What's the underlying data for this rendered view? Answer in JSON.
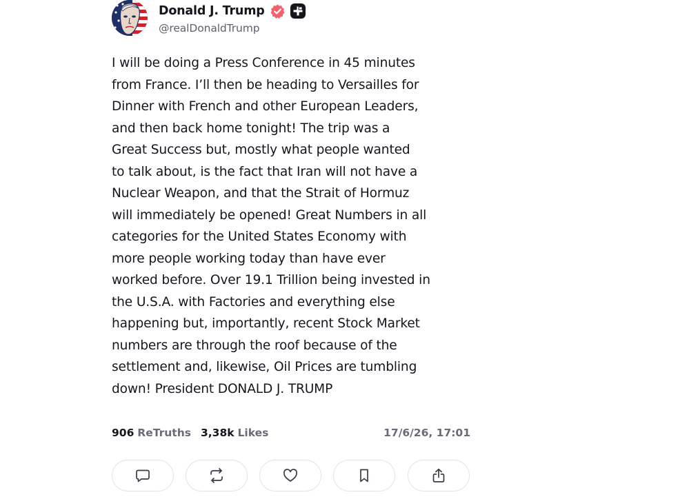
{
  "author": {
    "display_name": "Donald J. Trump",
    "handle": "@realDonaldTrump",
    "verified_icon": "verified-badge-icon",
    "subscribe_icon": "subscribe-plus-icon",
    "avatar_icon": "profile-avatar"
  },
  "post": {
    "lines": [
      "I will be doing a Press Conference in 45 minutes",
      "from France. I’ll then be heading to Versailles for",
      "Dinner with French and other European Leaders,",
      "and then back home tonight! The trip was a",
      "Great Success but, mostly what people wanted",
      "to talk about, is the fact that Iran will not have a",
      "Nuclear Weapon, and that the Strait of Hormuz",
      "will immediately be opened! Great Numbers in all",
      "categories for the United States Economy with",
      "more people working today than have ever",
      "worked before. Over 19.1 Trillion being invested in",
      "the U.S.A. with Factories and everything else",
      "happening but, importantly, recent Stock Market",
      "numbers are through the roof because of the",
      "settlement and, likewise, Oil Prices are tumbling",
      "down! President DONALD J. TRUMP"
    ]
  },
  "stats": {
    "retruths_count": "906",
    "retruths_label": "ReTruths",
    "likes_count": "3,38k",
    "likes_label": "Likes",
    "timestamp": "17/6/26, 17:01"
  },
  "actions": [
    {
      "name": "reply",
      "icon": "comment-icon"
    },
    {
      "name": "retruth",
      "icon": "repost-icon"
    },
    {
      "name": "like",
      "icon": "heart-icon"
    },
    {
      "name": "bookmark",
      "icon": "bookmark-icon"
    },
    {
      "name": "share",
      "icon": "share-icon"
    }
  ],
  "colors": {
    "verified_badge": "#f0636c",
    "text_primary": "#16151d",
    "text_secondary": "#6b6a78",
    "button_border": "#e4e3ea"
  }
}
